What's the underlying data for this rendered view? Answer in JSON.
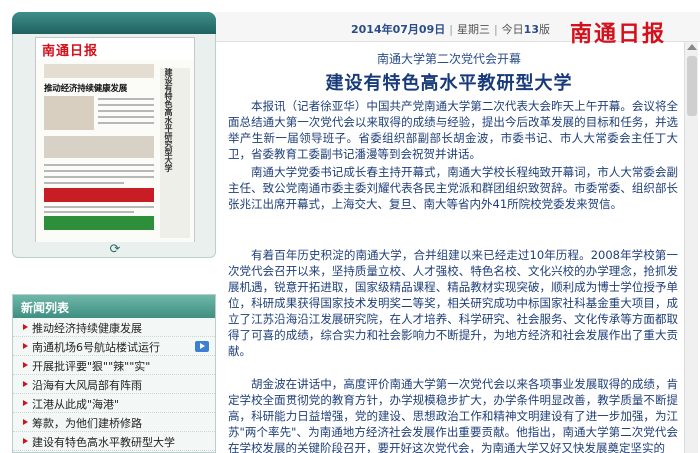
{
  "header": {
    "date": "2014年07月09日",
    "weekday": "星期三",
    "edition_prefix": "今日",
    "edition_count": "13",
    "edition_suffix": "版",
    "logo_text": "南通日报"
  },
  "thumbnail": {
    "masthead": "南通日报",
    "headline": "推动经济持续健康发展",
    "side_text": "建设有特色高水平研究型大学"
  },
  "news_list": {
    "title": "新闻列表",
    "items": [
      {
        "label": "推动经济持续健康发展",
        "has_video": false
      },
      {
        "label": "南通机场6号航站楼试运行",
        "has_video": true
      },
      {
        "label": "开展批评要\"狠\"\"辣\"\"实\"",
        "has_video": false
      },
      {
        "label": "沿海有大风局部有阵雨",
        "has_video": false
      },
      {
        "label": "江港从此成\"海港\"",
        "has_video": false
      },
      {
        "label": "筹款，为他们建桥修路",
        "has_video": false
      },
      {
        "label": "建设有特色高水平教研型大学",
        "has_video": false
      }
    ]
  },
  "article": {
    "subtitle": "南通大学第二次党代会开幕",
    "title": "建设有特色高水平教研型大学",
    "paragraphs": [
      "本报讯（记者徐亚华）中国共产党南通大学第二次代表大会昨天上午开幕。会议将全面总结通大第一次党代会以来取得的成绩与经验，提出今后改革发展的目标和任务，并选举产生新一届领导班子。省委组织部副部长胡金波，市委书记、市人大常委会主任丁大卫，省委教育工委副书记潘漫等到会祝贺并讲话。",
      "南通大学党委书记成长春主持开幕式，南通大学校长程纯致开幕词，市人大常委会副主任、致公党南通市委主委刘耀代表各民主党派和群团组织致贺辞。市委常委、组织部长张兆江出席开幕式，上海交大、复旦、南大等省内外41所院校党委发来贺信。",
      "有着百年历史积淀的南通大学，合并组建以来已经走过10年历程。2008年学校第一次党代会召开以来，坚持质量立校、人才强校、特色名校、文化兴校的办学理念，抢抓发展机遇，锐意开拓进取，国家级精品课程、精品教材实现突破，顺利成为博士学位授予单位，科研成果获得国家技术发明奖二等奖，相关研究成功中标国家社科基金重大项目，成立了江苏沿海沿江发展研究院，在人才培养、科学研究、社会服务、文化传承等方面都取得了可喜的成绩，综合实力和社会影响力不断提升，为地方经济和社会发展作出了重大贡献。",
      "胡金波在讲话中，高度评价南通大学第一次党代会以来各项事业发展取得的成绩，肯定学校全面贯彻党的教育方针，办学规模稳步扩大，办学条件明显改善，教学质量不断提高，科研能力日益增强，党的建设、思想政治工作和精神文明建设有了进一步加强，为江苏\"两个率先\"、为南通地方经济社会发展作出重要贡献。他指出，南通大学第二次党代会在学校发展的关键阶段召开，要开好这次党代会，为南通大学又好又快发展奠定坚实的"
    ]
  }
}
